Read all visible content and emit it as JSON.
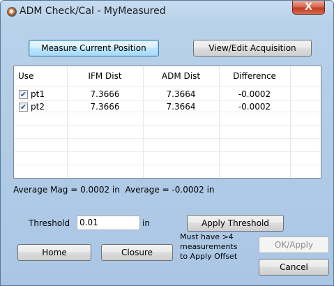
{
  "window": {
    "title": "ADM Check/Cal - MyMeasured",
    "close_glyph": "X"
  },
  "top_buttons": {
    "measure": "Measure Current Position",
    "view_edit": "View/Edit Acquisition"
  },
  "grid": {
    "headers": [
      "Use",
      "IFM Dist",
      "ADM Dist",
      "Difference"
    ],
    "rows": [
      {
        "checked": true,
        "use": "pt1",
        "ifm": "7.3666",
        "adm": "7.3664",
        "diff": "-0.0002"
      },
      {
        "checked": true,
        "use": "pt2",
        "ifm": "7.3666",
        "adm": "7.3664",
        "diff": "-0.0002"
      }
    ]
  },
  "summary": "Average Mag = 0.0002 in  Average = -0.0002 in",
  "threshold": {
    "label": "Threshold",
    "value": "0.01",
    "unit": "in",
    "apply": "Apply Threshold"
  },
  "bottom": {
    "home": "Home",
    "closure": "Closure",
    "note_line1": "Must have >4",
    "note_line2": "measurements",
    "note_line3": "to Apply Offset",
    "ok_apply": "OK/Apply",
    "cancel": "Cancel"
  }
}
